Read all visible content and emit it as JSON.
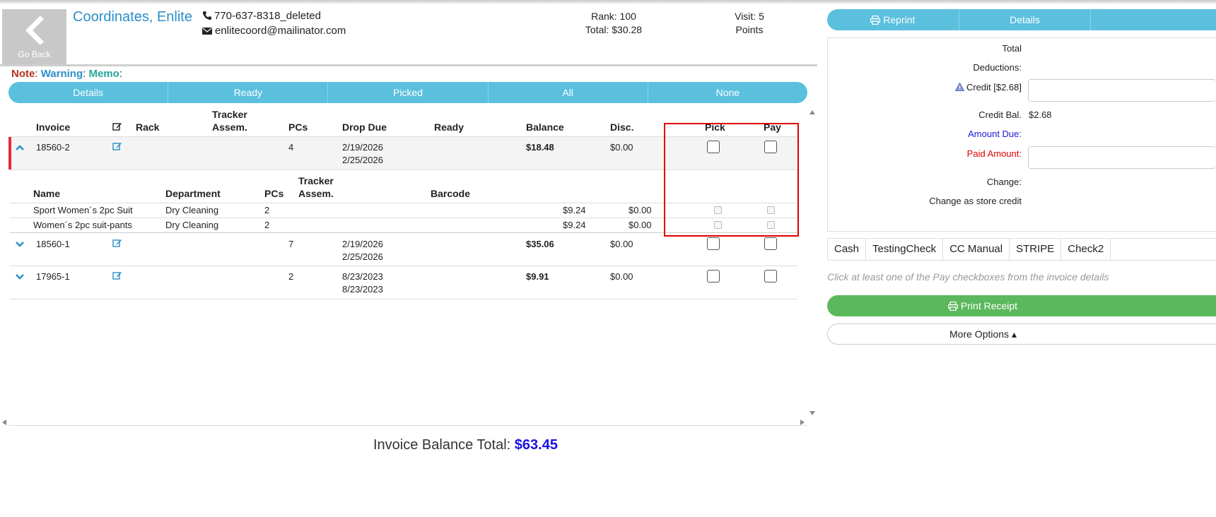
{
  "header": {
    "go_back_label": "Go Back",
    "customer_name": "Coordinates, Enlite",
    "phone": "770-637-8318_deleted",
    "email": "enlitecoord@mailinator.com",
    "rank": "Rank: 100",
    "total": "Total: $30.28",
    "visit": "Visit: 5",
    "points": "Points"
  },
  "notes": {
    "note": "Note",
    "warning": "Warning",
    "memo": "Memo",
    "sep": ":"
  },
  "filters": [
    "Details",
    "Ready",
    "Picked",
    "All",
    "None"
  ],
  "invoice_table": {
    "headers": {
      "invoice": "Invoice",
      "rack": "Rack",
      "tracker": "Tracker",
      "assem": "Assem.",
      "pcs": "PCs",
      "drop_due": "Drop Due",
      "ready": "Ready",
      "balance": "Balance",
      "disc": "Disc.",
      "pick": "Pick",
      "pay": "Pay"
    },
    "rows": [
      {
        "invoice": "18560-2",
        "pcs": "4",
        "drop": "2/19/2026",
        "due": "2/25/2026",
        "balance": "$18.48",
        "disc": "$0.00",
        "expanded": true
      },
      {
        "invoice": "18560-1",
        "pcs": "7",
        "drop": "2/19/2026",
        "due": "2/25/2026",
        "balance": "$35.06",
        "disc": "$0.00",
        "expanded": false
      },
      {
        "invoice": "17965-1",
        "pcs": "2",
        "drop": "8/23/2023",
        "due": "8/23/2023",
        "balance": "$9.91",
        "disc": "$0.00",
        "expanded": false
      }
    ]
  },
  "item_table": {
    "headers": {
      "name": "Name",
      "department": "Department",
      "pcs": "PCs",
      "tracker": "Tracker",
      "assem": "Assem.",
      "barcode": "Barcode"
    },
    "rows": [
      {
        "name": "Sport Women´s 2pc Suit",
        "department": "Dry Cleaning",
        "pcs": "2",
        "price": "$9.24",
        "disc": "$0.00"
      },
      {
        "name": "Women´s 2pc suit-pants",
        "department": "Dry Cleaning",
        "pcs": "2",
        "price": "$9.24",
        "disc": "$0.00"
      }
    ]
  },
  "footer": {
    "balance_label": "Invoice Balance Total:",
    "balance_value": "$63.45"
  },
  "right_panel": {
    "tabs": [
      "Reprint",
      "Details",
      ""
    ],
    "labels": {
      "total": "Total",
      "deductions": "Deductions:",
      "credit": "Credit [$2.68]",
      "credit_bal": "Credit Bal.",
      "credit_bal_value": "$2.68",
      "amount_due": "Amount Due:",
      "paid_amount": "Paid Amount:",
      "change": "Change:",
      "change_store_credit": "Change as store credit"
    },
    "colors": {
      "amount_due": "#1a1ad6",
      "paid_amount": "#e00000"
    },
    "payment_methods": [
      "Cash",
      "TestingCheck",
      "CC Manual",
      "STRIPE",
      "Check2"
    ],
    "hint": "Click at least one of the Pay checkboxes from the invoice details",
    "print_receipt": "Print Receipt",
    "more_options": "More Options ▴"
  }
}
